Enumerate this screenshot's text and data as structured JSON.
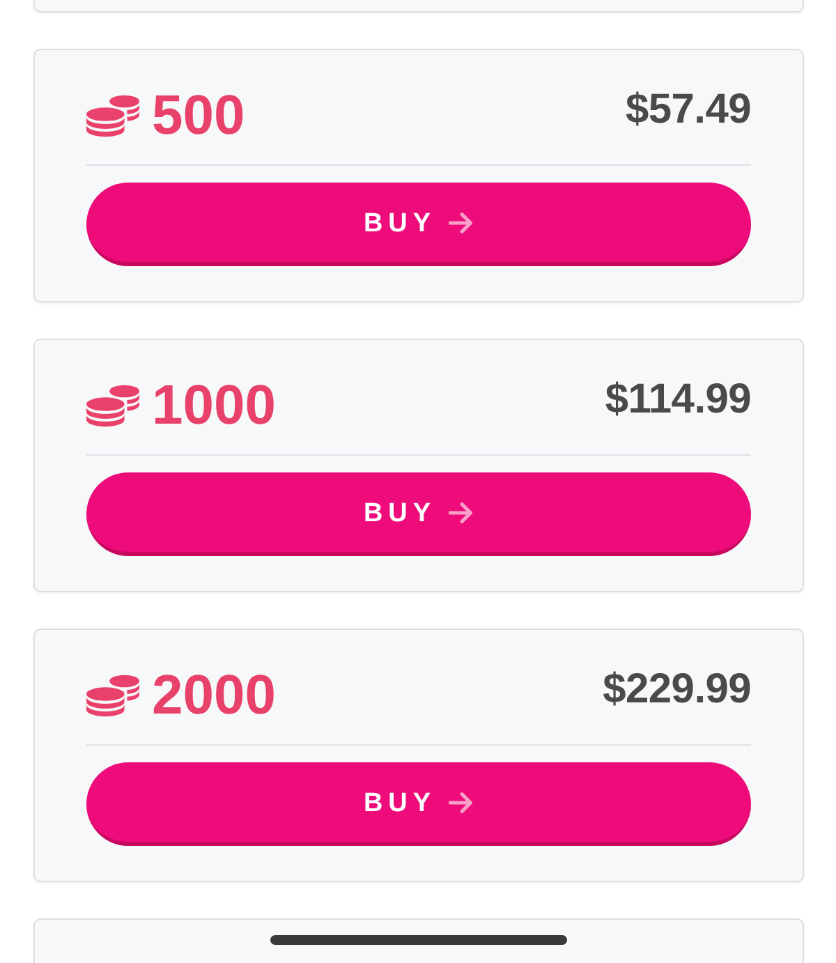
{
  "packages": [
    {
      "amount": "500",
      "price": "$57.49",
      "button": {
        "label": "BUY"
      }
    },
    {
      "amount": "1000",
      "price": "$114.99",
      "button": {
        "label": "BUY"
      }
    },
    {
      "amount": "2000",
      "price": "$229.99",
      "button": {
        "label": "BUY"
      }
    }
  ]
}
